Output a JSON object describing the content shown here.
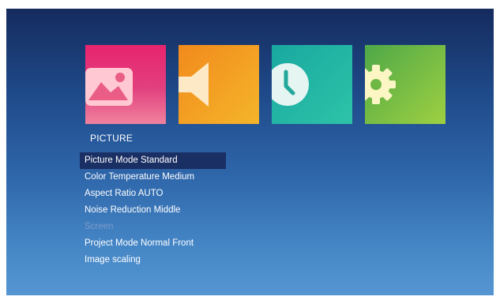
{
  "section_title": "PICTURE",
  "tiles": [
    {
      "name": "picture",
      "icon": "image-icon",
      "color": "#e2407f"
    },
    {
      "name": "sound",
      "icon": "speaker-icon",
      "color": "#f5a623"
    },
    {
      "name": "time",
      "icon": "clock-icon",
      "color": "#22b5a4"
    },
    {
      "name": "setup",
      "icon": "gear-icon",
      "color": "#7cc044"
    }
  ],
  "menu": {
    "items": [
      {
        "label": "Picture Mode Standard",
        "state": "selected"
      },
      {
        "label": "Color Temperature Medium",
        "state": "normal"
      },
      {
        "label": "Aspect Ratio AUTO",
        "state": "normal"
      },
      {
        "label": "Noise Reduction Middle",
        "state": "normal"
      },
      {
        "label": "Screen",
        "state": "disabled"
      },
      {
        "label": "Project Mode Normal Front",
        "state": "normal"
      },
      {
        "label": "Image scaling",
        "state": "normal"
      }
    ]
  }
}
